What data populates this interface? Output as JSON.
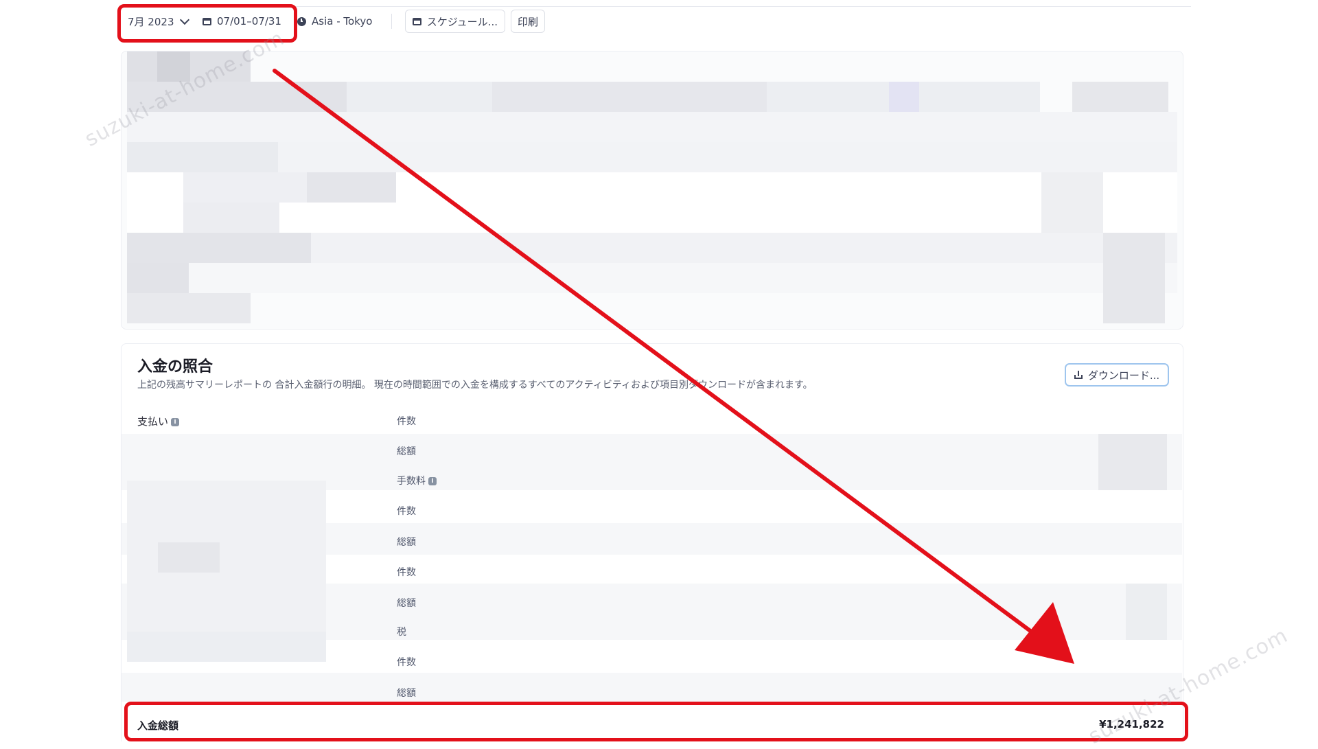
{
  "toolbar": {
    "month": "7月 2023",
    "date_range": "07/01–07/31",
    "timezone": "Asia - Tokyo",
    "schedule": "スケジュール...",
    "print": "印刷"
  },
  "section": {
    "title": "入金の照合",
    "description": "上記の残高サマリーレポートの 合計入金額行の明細。 現在の時間範囲での入金を構成するすべてのアクティビティおよび項目別ダウンロードが含まれます。",
    "download_label": "ダウンロード..."
  },
  "table": {
    "group_label": "支払い",
    "rows": [
      {
        "label": "件数",
        "info": false
      },
      {
        "label": "総額",
        "info": false
      },
      {
        "label": "手数料",
        "info": true
      },
      {
        "label": "件数",
        "info": false
      },
      {
        "label": "総額",
        "info": false
      },
      {
        "label": "件数",
        "info": false
      },
      {
        "label": "総額",
        "info": false
      },
      {
        "label": "税",
        "info": false
      },
      {
        "label": "件数",
        "info": false
      },
      {
        "label": "総額",
        "info": false
      }
    ]
  },
  "total": {
    "label": "入金総額",
    "value": "¥1,241,822"
  },
  "watermarks": [
    "suzuki-at-home.com",
    "suzuki-at-home.com"
  ],
  "colors": {
    "highlight": "#e3101a",
    "button_focus": "#9ec5ee"
  },
  "icons": [
    "chevron-down-icon",
    "calendar-icon",
    "clock-icon",
    "download-icon",
    "info-icon"
  ]
}
